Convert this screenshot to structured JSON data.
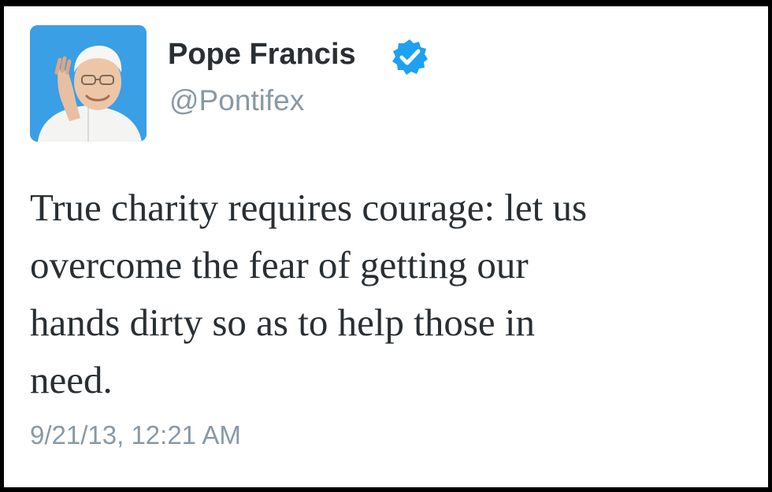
{
  "tweet": {
    "author": {
      "name": "Pope Francis",
      "handle": "@Pontifex",
      "verified_icon": "verified-badge-icon",
      "verified_color": "#1da1f2"
    },
    "text_lines": [
      "True charity requires courage: let us",
      "overcome the fear of getting our",
      "hands dirty so as to help those in",
      "need."
    ],
    "timestamp": "9/21/13, 12:21 AM"
  }
}
